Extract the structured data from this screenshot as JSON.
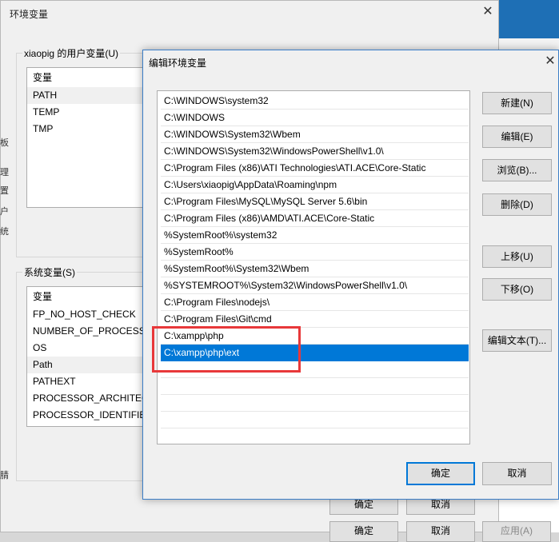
{
  "background_window": {
    "title": "环境变量",
    "close_glyph": "✕",
    "user_group_title": "xiaopig 的用户变量(U)",
    "user_list": {
      "header": "变量",
      "items": [
        "PATH",
        "TEMP",
        "TMP"
      ]
    },
    "system_group_title": "系统变量(S)",
    "system_list": {
      "header": "变量",
      "items": [
        "FP_NO_HOST_CHECK",
        "NUMBER_OF_PROCESSO",
        "OS",
        "Path",
        "PATHEXT",
        "PROCESSOR_ARCHITEC",
        "PROCESSOR_IDENTIFIE"
      ]
    },
    "left_edge_glyphs": [
      "板",
      "理",
      "置",
      "户",
      "统",
      "腈"
    ],
    "bottom_buttons": {
      "ok_label": "确定",
      "cancel_label": "取消"
    },
    "lower_buttons": {
      "ok_label": "确定",
      "cancel_label": "取消",
      "apply_label": "应用(A)"
    }
  },
  "dialog": {
    "title": "编辑环境变量",
    "close_glyph": "✕",
    "paths": [
      "C:\\WINDOWS\\system32",
      "C:\\WINDOWS",
      "C:\\WINDOWS\\System32\\Wbem",
      "C:\\WINDOWS\\System32\\WindowsPowerShell\\v1.0\\",
      "C:\\Program Files (x86)\\ATI Technologies\\ATI.ACE\\Core-Static",
      "C:\\Users\\xiaopig\\AppData\\Roaming\\npm",
      "C:\\Program Files\\MySQL\\MySQL Server 5.6\\bin",
      "C:\\Program Files (x86)\\AMD\\ATI.ACE\\Core-Static",
      "%SystemRoot%\\system32",
      "%SystemRoot%",
      "%SystemRoot%\\System32\\Wbem",
      "%SYSTEMROOT%\\System32\\WindowsPowerShell\\v1.0\\",
      "C:\\Program Files\\nodejs\\",
      "C:\\Program Files\\Git\\cmd",
      "C:\\xampp\\php",
      "C:\\xampp\\php\\ext"
    ],
    "selected_index": 15,
    "buttons": {
      "new": "新建(N)",
      "edit": "编辑(E)",
      "browse": "浏览(B)...",
      "delete": "删除(D)",
      "move_up": "上移(U)",
      "move_down": "下移(O)",
      "edit_text": "编辑文本(T)...",
      "ok": "确定",
      "cancel": "取消"
    },
    "selection_color": "#0078d7",
    "highlight_color": "#e8383a"
  }
}
